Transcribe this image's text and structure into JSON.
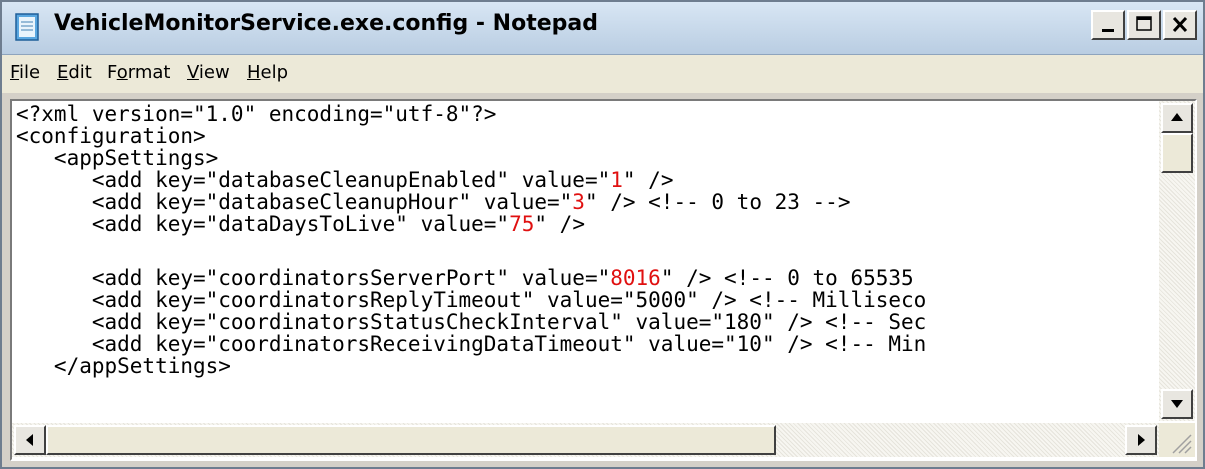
{
  "window": {
    "title": "VehicleMonitorService.exe.config - Notepad",
    "icon": "notepad-icon"
  },
  "menu": {
    "items": [
      {
        "label": "File",
        "mnemonic": "F"
      },
      {
        "label": "Edit",
        "mnemonic": "E"
      },
      {
        "label": "Format",
        "mnemonic": "o"
      },
      {
        "label": "View",
        "mnemonic": "V"
      },
      {
        "label": "Help",
        "mnemonic": "H"
      }
    ]
  },
  "editor": {
    "lines": [
      {
        "pre": "<?xml version=\"1.0\" encoding=\"utf-8\"?>",
        "val": "",
        "post": ""
      },
      {
        "pre": "<configuration>",
        "val": "",
        "post": ""
      },
      {
        "pre": "   <appSettings>",
        "val": "",
        "post": ""
      },
      {
        "pre": "      <add key=\"databaseCleanupEnabled\" value=\"",
        "val": "1",
        "post": "\" />"
      },
      {
        "pre": "      <add key=\"databaseCleanupHour\" value=\"",
        "val": "3",
        "post": "\" /> <!-- 0 to 23 -->"
      },
      {
        "pre": "      <add key=\"dataDaysToLive\" value=\"",
        "val": "75",
        "post": "\" />"
      },
      {
        "pre": "",
        "val": "",
        "post": ""
      },
      {
        "pre": "      <add key=\"coordinatorsServerPort\" value=\"",
        "val": "8016",
        "post": "\" /> <!-- 0 to 65535"
      },
      {
        "pre": "      <add key=\"coordinatorsReplyTimeout\" value=\"5000\" /> <!-- Milliseco",
        "val": "",
        "post": ""
      },
      {
        "pre": "      <add key=\"coordinatorsStatusCheckInterval\" value=\"180\" /> <!-- Sec",
        "val": "",
        "post": ""
      },
      {
        "pre": "      <add key=\"coordinatorsReceivingDataTimeout\" value=\"10\" /> <!-- Min",
        "val": "",
        "post": ""
      },
      {
        "pre": "   </appSettings>",
        "val": "",
        "post": ""
      }
    ]
  },
  "colors": {
    "highlight_value": "#e01010",
    "titlebar": "#c8d8ea"
  }
}
